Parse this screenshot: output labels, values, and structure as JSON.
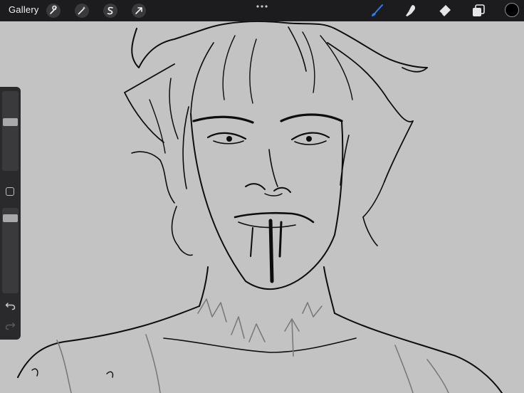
{
  "topbar": {
    "gallery_label": "Gallery",
    "left_tools": [
      {
        "name": "actions",
        "icon": "wrench-icon"
      },
      {
        "name": "adjustments",
        "icon": "magic-wand-icon"
      },
      {
        "name": "selection",
        "icon": "selection-s-icon"
      },
      {
        "name": "transform",
        "icon": "arrow-cursor-icon"
      }
    ],
    "more_icon": "ellipsis-icon",
    "right_tools": [
      {
        "name": "brush",
        "icon": "brush-icon",
        "active": true
      },
      {
        "name": "smudge",
        "icon": "smudge-finger-icon",
        "active": false
      },
      {
        "name": "eraser",
        "icon": "eraser-icon",
        "active": false
      },
      {
        "name": "layers",
        "icon": "layers-icon",
        "active": false
      }
    ],
    "current_color": "#000000"
  },
  "sidebar": {
    "brush_size_level": 0.62,
    "opacity_level": 0.92,
    "modify_icon": "square-icon",
    "undo_icon": "undo-icon",
    "redo_icon": "redo-icon",
    "redo_enabled": false
  },
  "colors": {
    "toolbar_bg": "#1c1c1e",
    "canvas_bg": "#c3c3c3",
    "active_tool": "#2f7bf5",
    "ink": "#0d0d0d",
    "sketch_gray": "#7a7a7a"
  }
}
